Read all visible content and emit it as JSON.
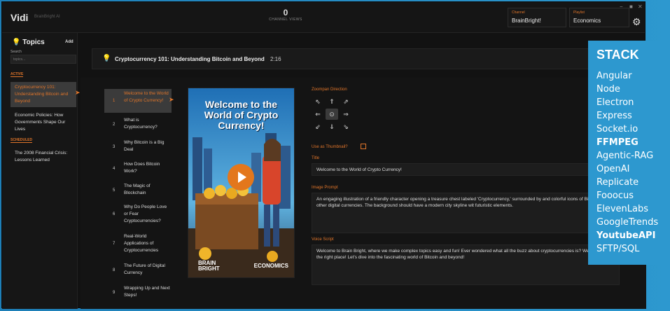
{
  "app": {
    "name": "Vidi",
    "subtitle": "BrainBright AI"
  },
  "header": {
    "views_count": "0",
    "views_label": "CHANNEL VIEWS",
    "channel_caption": "Channel",
    "channel_value": "BrainBright!",
    "playlist_caption": "Playlist",
    "playlist_value": "Economics",
    "window_controls": [
      "−",
      "■",
      "✕"
    ]
  },
  "sidebar": {
    "title": "Topics",
    "add_label": "Add",
    "search_label": "Search",
    "search_placeholder": "topics...",
    "active_label": "ACTIVE",
    "scheduled_label": "SCHEDULED",
    "active_topics": [
      "Cryptocurrency 101: Understanding Bitcoin and Beyond",
      "Economic Policies: How Governments Shape Our Lives"
    ],
    "scheduled_topics": [
      "The 2008 Financial Crisis: Lessons Learned"
    ]
  },
  "topic_header": {
    "title": "Cryptocurrency 101: Understanding Bitcoin and Beyond",
    "duration": "2:16"
  },
  "steps": [
    {
      "n": "1",
      "label": "Welcome to the World of Crypto Currency!"
    },
    {
      "n": "2",
      "label": "What is Cryptocurrency?"
    },
    {
      "n": "3",
      "label": "Why Bitcoin is a Big Deal"
    },
    {
      "n": "4",
      "label": "How Does Bitcoin Work?"
    },
    {
      "n": "5",
      "label": "The Magic of Blockchain"
    },
    {
      "n": "6",
      "label": "Why Do People Love or Fear Cryptocurrencies?"
    },
    {
      "n": "7",
      "label": "Real-World Applications of Cryptocurrencies"
    },
    {
      "n": "8",
      "label": "The Future of Digital Currency"
    },
    {
      "n": "9",
      "label": "Wrapping Up and Next Steps!"
    }
  ],
  "thumbnail": {
    "title_line1": "Welcome to the",
    "title_line2": "World of Crypto",
    "title_line3": "Currency!",
    "brand_line1": "BRAIN",
    "brand_line2": "BRIGHT",
    "category": "ECONOMICS"
  },
  "editor": {
    "zoompan_label": "Zoompan Direction",
    "directions": [
      "⇖",
      "⇑",
      "⇗",
      "⇐",
      "⊙",
      "⇒",
      "⇙",
      "⇓",
      "⇘"
    ],
    "use_thumbnail_label": "Use as Thumbnail?",
    "title_label": "Title",
    "title_value": "Welcome to the World of Crypto Currency!",
    "image_prompt_label": "Image Prompt",
    "image_prompt_value": "An engaging illustration of a friendly character opening a treasure chest labeled 'Cryptocurrency,' surrounded by and colorful icons of Bitcoin and other digital currencies. The background should have a modern city skyline wit futuristic elements.",
    "voice_script_label": "Voice Script",
    "voice_script_value": "Welcome to Brain Bright, where we make complex topics easy and fun! Ever wondered what all the buzz about cryptocurrencies is? Well, you're in the right place! Let's dive into the fascinating world of Bitcoin and beyond!"
  },
  "stack": {
    "title": "STACK",
    "items": [
      "Angular",
      "Node",
      "Electron",
      "Express",
      "Socket.io",
      "FFMPEG",
      "Agentic-RAG",
      "OpenAI",
      "Replicate",
      "Fooocus",
      "ElevenLabs",
      "GoogleTrends",
      "YoutubeAPI",
      "SFTP/SQL"
    ],
    "bold_items": [
      "FFMPEG",
      "YoutubeAPI"
    ]
  },
  "colors": {
    "accent": "#e0752a",
    "stack_bg": "#2d98cf",
    "app_bg": "#121212"
  }
}
